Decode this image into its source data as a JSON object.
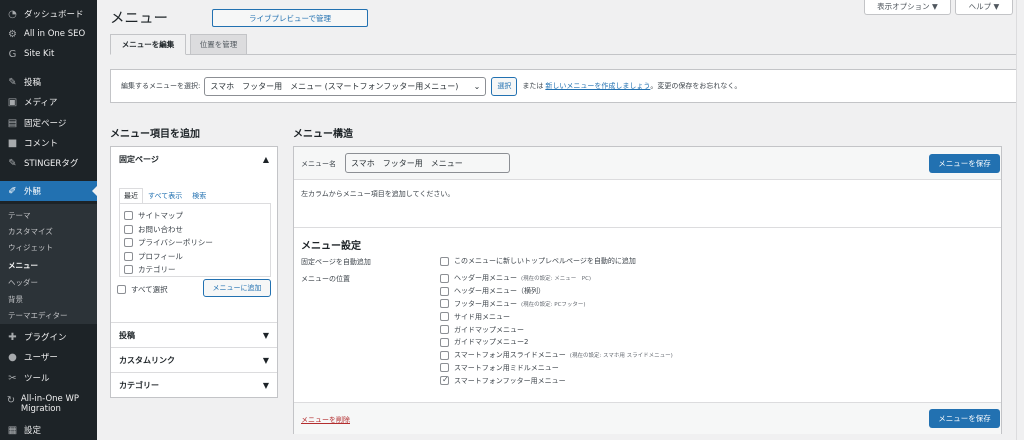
{
  "sidebar": {
    "items": [
      {
        "label": "ダッシュボード",
        "icon": "dashboard-icon"
      },
      {
        "label": "All in One SEO",
        "icon": "gear-icon"
      },
      {
        "label": "Site Kit",
        "icon": "google-icon"
      },
      {
        "label": "投稿",
        "icon": "pin-icon"
      },
      {
        "label": "メディア",
        "icon": "media-icon"
      },
      {
        "label": "固定ページ",
        "icon": "page-icon"
      },
      {
        "label": "コメント",
        "icon": "comment-icon"
      },
      {
        "label": "STINGERタグ",
        "icon": "pin-icon"
      },
      {
        "label": "外観",
        "icon": "brush-icon"
      },
      {
        "label": "プラグイン",
        "icon": "plugin-icon"
      },
      {
        "label": "ユーザー",
        "icon": "user-icon"
      },
      {
        "label": "ツール",
        "icon": "wrench-icon"
      },
      {
        "label": "All-in-One WP Migration",
        "icon": "migration-icon"
      },
      {
        "label": "設定",
        "icon": "settings-icon"
      }
    ],
    "submenu": [
      "テーマ",
      "カスタマイズ",
      "ウィジェット",
      "メニュー",
      "ヘッダー",
      "背景",
      "テーマエディター"
    ]
  },
  "header": {
    "title": "メニュー",
    "live_preview": "ライブプレビューで管理",
    "screen_options": "表示オプション ▼",
    "help": "ヘルプ ▼"
  },
  "tabs": {
    "edit": "メニューを編集",
    "manage": "位置を管理"
  },
  "manage": {
    "label": "編集するメニューを選択:",
    "selected": "スマホ　フッター用　メニュー (スマートフォンフッター用メニュー)",
    "select_button": "選択",
    "or_text": "または",
    "create_link": "新しいメニューを作成しましょう",
    "suffix": "。変更の保存をお忘れなく。"
  },
  "add_items": {
    "title": "メニュー項目を追加",
    "pages": "固定ページ",
    "tabs": [
      "最近",
      "すべて表示",
      "検索"
    ],
    "pages_list": [
      "サイトマップ",
      "お問い合わせ",
      "プライバシーポリシー",
      "プロフィール",
      "カテゴリー"
    ],
    "select_all": "すべて選択",
    "add_button": "メニューに追加",
    "posts": "投稿",
    "custom_links": "カスタムリンク",
    "categories": "カテゴリー"
  },
  "structure": {
    "title": "メニュー構造",
    "name_label": "メニュー名",
    "name_value": "スマホ　フッター用　メニュー",
    "save": "メニューを保存",
    "instructions": "左カラムからメニュー項目を追加してください。",
    "settings_title": "メニュー設定",
    "auto_label": "固定ページを自動追加",
    "auto_text": "このメニューに新しいトップレベルページを自動的に追加",
    "location_label": "メニューの位置",
    "locations": [
      {
        "label": "ヘッダー用メニュー",
        "note": "(現在の設定: メニュー　PC)",
        "checked": false
      },
      {
        "label": "ヘッダー用メニュー（横列）",
        "note": "",
        "checked": false
      },
      {
        "label": "フッター用メニュー",
        "note": "(現在の設定: PCフッター)",
        "checked": false
      },
      {
        "label": "サイド用メニュー",
        "note": "",
        "checked": false
      },
      {
        "label": "ガイドマップメニュー",
        "note": "",
        "checked": false
      },
      {
        "label": "ガイドマップメニュー2",
        "note": "",
        "checked": false
      },
      {
        "label": "スマートフォン用スライドメニュー",
        "note": "(現在の設定: スマホ用 スライドメニュー)",
        "checked": false
      },
      {
        "label": "スマートフォン用ミドルメニュー",
        "note": "",
        "checked": false
      },
      {
        "label": "スマートフォンフッター用メニュー",
        "note": "",
        "checked": true
      }
    ],
    "delete": "メニューを削除"
  }
}
